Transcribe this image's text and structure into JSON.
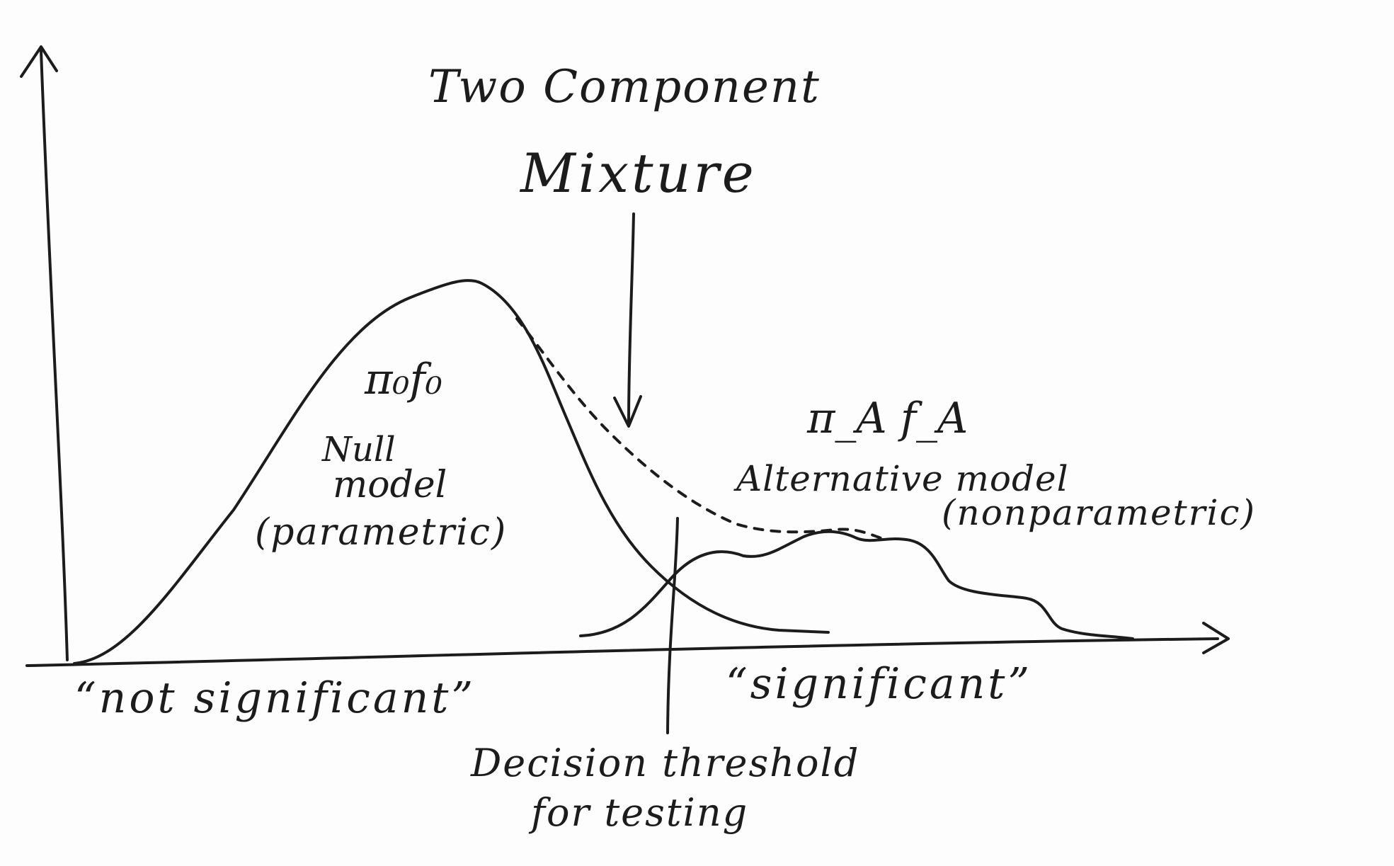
{
  "title": {
    "line1": "Two Component",
    "line2": "Mixture"
  },
  "null_component": {
    "symbol": "π₀f₀",
    "label_line1": "Null",
    "label_line2": "model",
    "label_line3": "(parametric)"
  },
  "alternative_component": {
    "symbol": "π_A f_A",
    "label_line1": "Alternative model",
    "label_line2": "(nonparametric)"
  },
  "regions": {
    "left": "“not significant”",
    "right": "“significant”"
  },
  "threshold": {
    "line1": "Decision threshold",
    "line2": "for testing"
  },
  "colors": {
    "ink": "#1c1c1c",
    "paper": "#fdfdfd"
  }
}
